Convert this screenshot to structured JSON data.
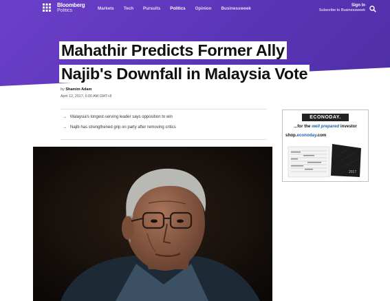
{
  "header": {
    "logo_line1": "Bloomberg",
    "logo_line2": "Politics",
    "nav": [
      "Markets",
      "Tech",
      "Pursuits",
      "Politics",
      "Opinion",
      "Businessweek"
    ],
    "active_nav": "Politics",
    "sign_in": "Sign In",
    "subscribe": "Subscribe to Businessweek"
  },
  "article": {
    "headline_line1": "Mahathir Predicts Former Ally",
    "headline_line2": "Najib's Downfall in Malaysia Vote",
    "byline_prefix": "by",
    "author": "Shamim Adam",
    "date": "April 12, 2017, 5:00 AM GMT+8",
    "bullets": [
      "Malaysia's longest-serving leader says opposition to win",
      "Najib has strengthened grip on party after removing critics"
    ]
  },
  "ad": {
    "brand": "ECONODAY.",
    "tagline_prefix": "...for the",
    "tagline_emphasis": "well prepared",
    "tagline_suffix": "investor",
    "url_prefix": "shop.",
    "url_domain": "econoday",
    "url_suffix": ".com",
    "planner_year": "2017"
  },
  "colors": {
    "hero_purple": "#5b35b8",
    "ad_link_blue": "#1a5fb4"
  },
  "icons": [
    "grid-icon",
    "search-icon",
    "arrow-right-icon"
  ]
}
